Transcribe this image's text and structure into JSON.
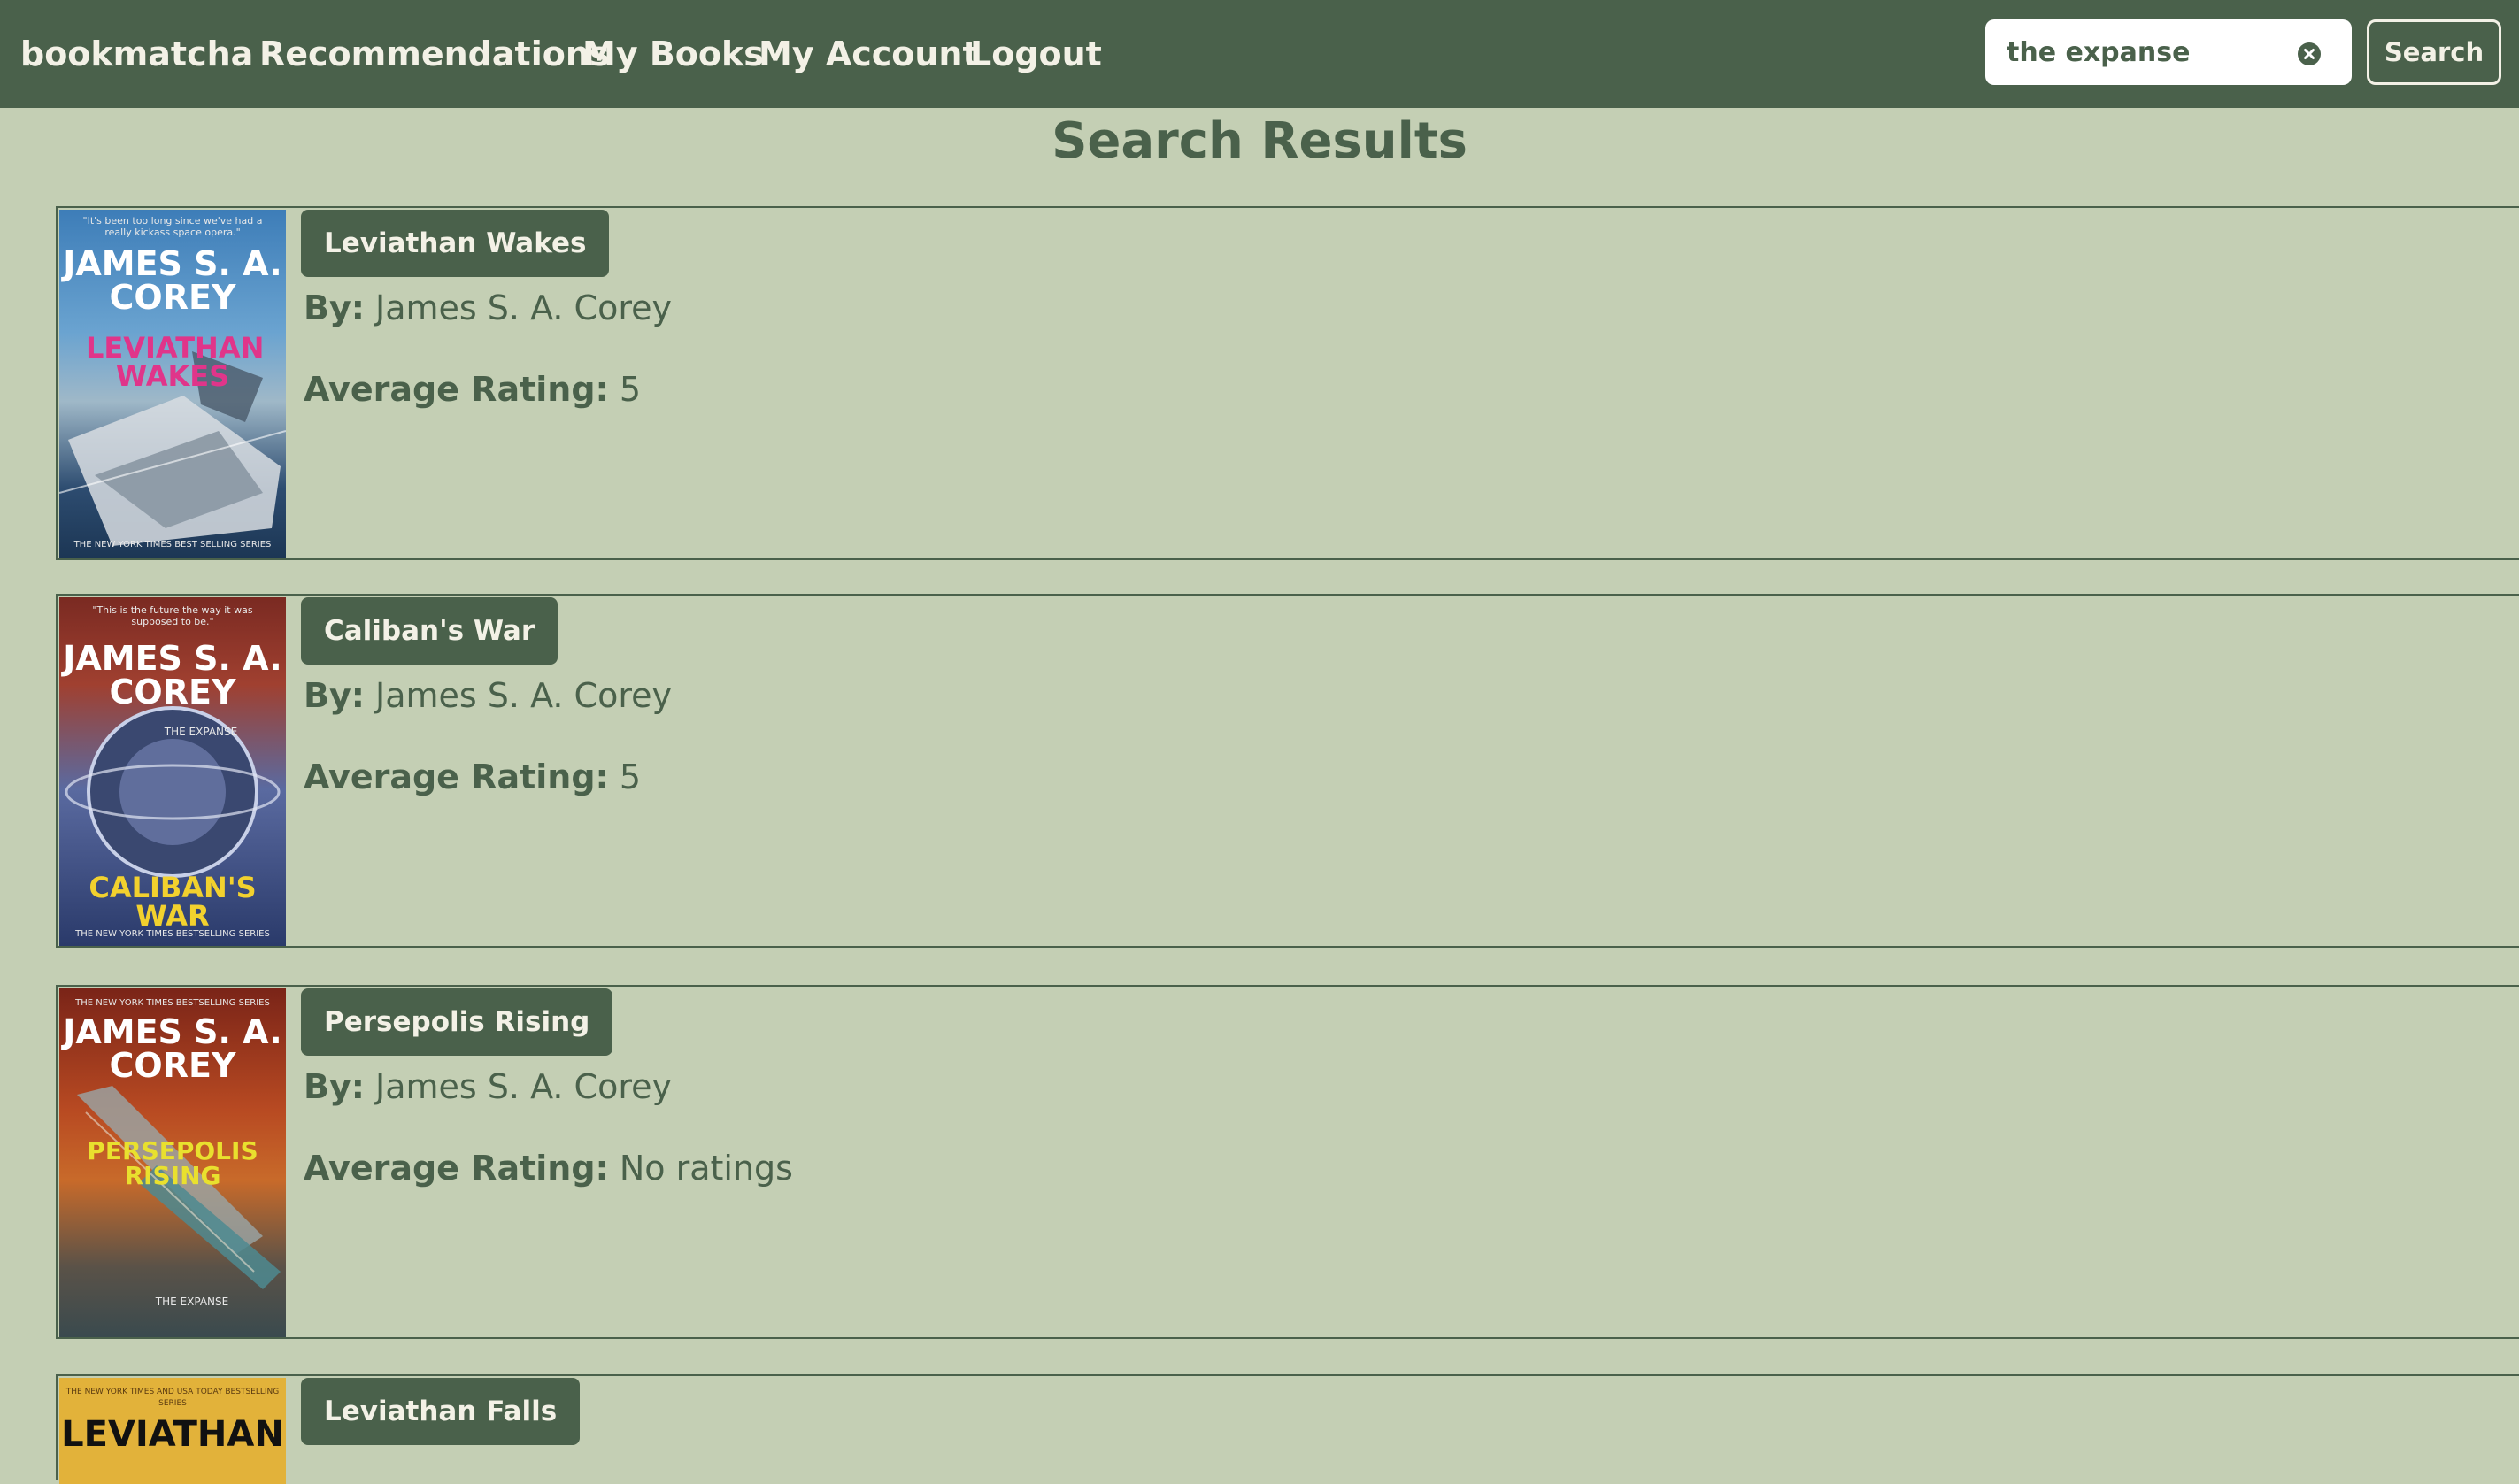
{
  "navbar": {
    "brand": "bookmatcha",
    "links": [
      "Recommendations",
      "My Books",
      "My Account",
      "Logout"
    ],
    "search": {
      "value": "the expanse",
      "button_label": "Search"
    }
  },
  "page_title": "Search Results",
  "labels": {
    "by": "By:",
    "rating": "Average Rating:"
  },
  "results": [
    {
      "title": "Leviathan Wakes",
      "author": "James S. A. Corey",
      "rating": "5",
      "cover": {
        "author_text": "JAMES S. A. COREY",
        "title_text": "LEVIATHAN WAKES",
        "top_quote": "\"It's been too long since we've had a really kickass space opera.\"",
        "bottom_text": "THE NEW YORK TIMES BEST SELLING SERIES",
        "title_color": "#e0358a",
        "bg_top": "#3d7db8",
        "bg_bottom": "#1c3654"
      }
    },
    {
      "title": "Caliban's War",
      "author": "James S. A. Corey",
      "rating": "5",
      "cover": {
        "author_text": "JAMES S. A. COREY",
        "title_text": "CALIBAN'S WAR",
        "top_quote": "\"This is the future the way it was supposed to be.\"",
        "sub_text": "THE EXPANSE",
        "bottom_text": "THE NEW YORK TIMES BESTSELLING SERIES",
        "title_color": "#f2d12e",
        "bg_top": "#7a2a22",
        "bg_bottom": "#2a3a6a"
      }
    },
    {
      "title": "Persepolis Rising",
      "author": "James S. A. Corey",
      "rating": "No ratings",
      "cover": {
        "author_text": "JAMES S. A. COREY",
        "title_text": "PERSEPOLIS RISING",
        "top_quote": "THE NEW YORK TIMES BESTSELLING SERIES",
        "sub_text": "THE EXPANSE",
        "title_color": "#e9e02e",
        "bg_top": "#a8321c",
        "bg_bottom": "#3a4a4e"
      }
    },
    {
      "title": "Leviathan Falls",
      "author": "",
      "rating": "",
      "cover": {
        "top_quote": "THE NEW YORK TIMES AND USA TODAY BESTSELLING SERIES",
        "title_text": "LEVIATHAN",
        "title_color": "#111111",
        "bg_top": "#e2b23a",
        "bg_bottom": "#e2b23a"
      }
    }
  ],
  "colors": {
    "navbar": "#4a614b",
    "page_bg": "#c4cfb4",
    "accent": "#4a614b",
    "nav_text": "#f3f1e6"
  }
}
